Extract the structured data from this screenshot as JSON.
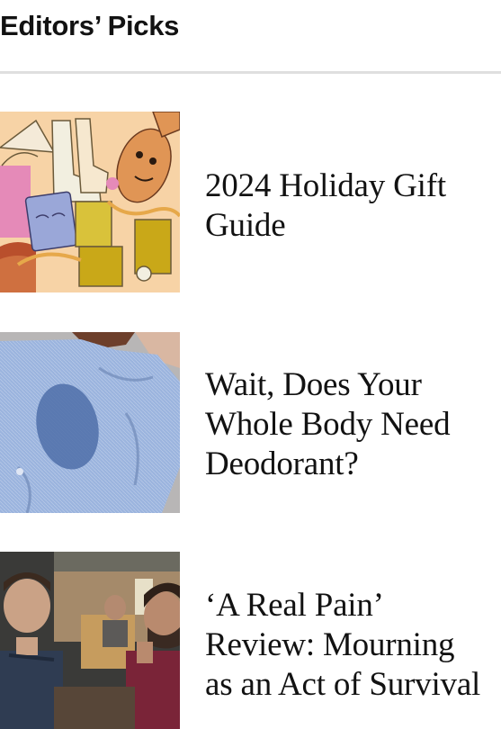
{
  "section": {
    "title": "Editors’ Picks"
  },
  "picks": [
    {
      "headline": "2024 Holiday Gift\nGuide",
      "image_icon": "gift-illustration-image"
    },
    {
      "headline": "Wait, Does Your\nWhole Body Need\nDeodorant?",
      "image_icon": "shirt-sweat-photo"
    },
    {
      "headline": "‘A Real Pain’\nReview: Mourning\nas an Act of Survival",
      "image_icon": "movie-still-photo"
    }
  ],
  "colors": {
    "divider": "#dfdfdf",
    "text": "#121212",
    "gift_bg": "#f7d3a6",
    "shirt_blue": "#9bb4de"
  }
}
